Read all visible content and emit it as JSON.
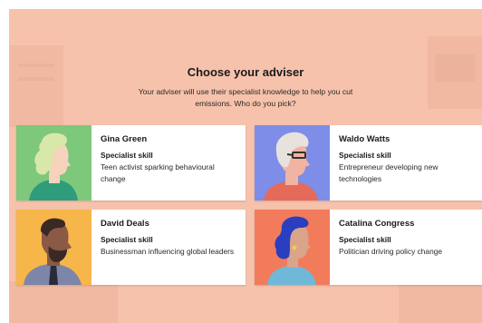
{
  "header": {
    "title": "Choose your adviser",
    "subtitle": "Your adviser will use their specialist knowledge to help you cut emissions. Who do you pick?"
  },
  "advisers": [
    {
      "name": "Gina Green",
      "skill_label": "Specialist skill",
      "skill": "Teen activist sparking behavioural change",
      "portrait_bg": "#7dc87a",
      "hair_color": "#d8e8a8",
      "skin_color": "#f5d3bd",
      "shirt_color": "#2f9c7c"
    },
    {
      "name": "Waldo Watts",
      "skill_label": "Specialist skill",
      "skill": "Entrepreneur developing new technologies",
      "portrait_bg": "#7d8de8",
      "hair_color": "#e8e2dc",
      "skin_color": "#f1b4a2",
      "shirt_color": "#e66a5a"
    },
    {
      "name": "David Deals",
      "skill_label": "Specialist skill",
      "skill": "Businessman influencing global leaders",
      "portrait_bg": "#f7b64a",
      "hair_color": "#3a2a26",
      "skin_color": "#8a5a44",
      "shirt_color": "#7d86a8"
    },
    {
      "name": "Catalina Congress",
      "skill_label": "Specialist skill",
      "skill": "Politician driving policy change",
      "portrait_bg": "#f27b5c",
      "hair_color": "#2a3ec0",
      "skin_color": "#d9a48a",
      "shirt_color": "#6fb8d8"
    }
  ]
}
